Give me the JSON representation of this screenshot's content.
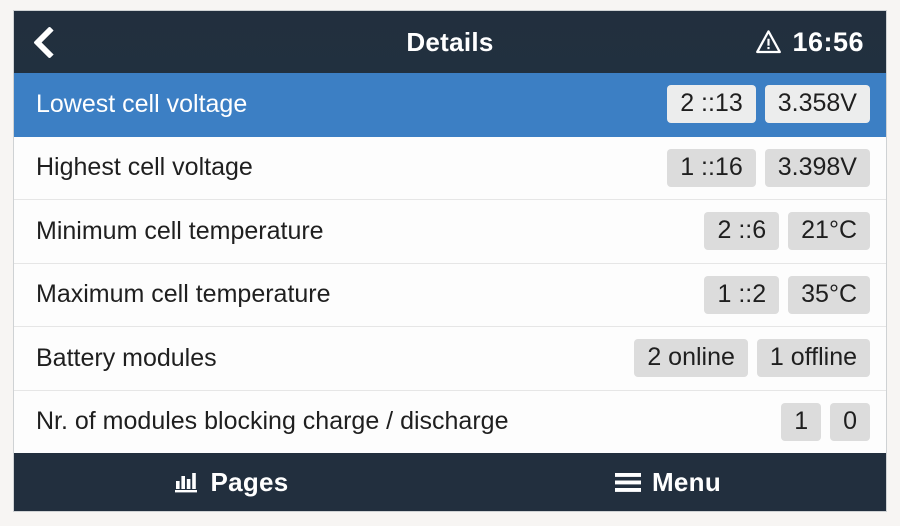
{
  "header": {
    "back_icon": "chevron-left-icon",
    "title": "Details",
    "warning_icon": "warning-triangle-icon",
    "time": "16:56"
  },
  "colors": {
    "topbar_bg": "#222f3e",
    "selected_row_bg": "#3c7fc4",
    "row_bg": "#fdfdfd",
    "chip_bg": "#dcdcdc",
    "selected_chip_bg": "#eceded",
    "text": "#1f1f1f",
    "text_inverse": "#ffffff",
    "divider": "#e6e6e6",
    "page_bg": "#f7f5f3"
  },
  "list": {
    "rows": [
      {
        "label": "Lowest cell voltage",
        "selected": true,
        "values": [
          "2 ::13",
          "3.358V"
        ]
      },
      {
        "label": "Highest cell voltage",
        "selected": false,
        "values": [
          "1 ::16",
          "3.398V"
        ]
      },
      {
        "label": "Minimum cell temperature",
        "selected": false,
        "values": [
          "2 ::6",
          "21°C"
        ]
      },
      {
        "label": "Maximum cell temperature",
        "selected": false,
        "values": [
          "1 ::2",
          "35°C"
        ]
      },
      {
        "label": "Battery modules",
        "selected": false,
        "values": [
          "2 online",
          "1 offline"
        ]
      },
      {
        "label": "Nr. of modules blocking charge / discharge",
        "selected": false,
        "values": [
          "1",
          "0"
        ]
      }
    ]
  },
  "footer": {
    "pages_icon": "bar-chart-icon",
    "pages_label": "Pages",
    "menu_icon": "hamburger-menu-icon",
    "menu_label": "Menu"
  }
}
